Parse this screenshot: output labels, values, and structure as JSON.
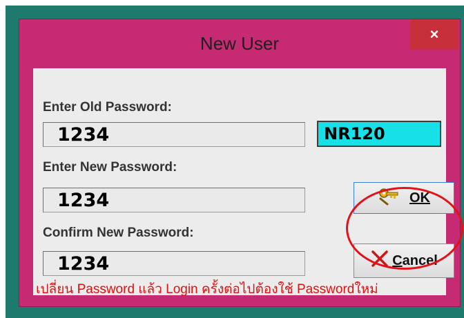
{
  "window": {
    "title": "New User",
    "close_glyph": "×"
  },
  "form": {
    "old_password_label": "Enter Old Password:",
    "old_password_value": "1234",
    "new_password_label": "Enter New Password:",
    "new_password_value": "1234",
    "confirm_password_label": "Confirm New Password:",
    "confirm_password_value": "1234",
    "user_code": "NR120"
  },
  "buttons": {
    "ok_label": "OK",
    "cancel_label": "Cancel"
  },
  "hint": "เปลี่ยน Password แล้ว Login ครั้งต่อไปต้องใช้ Passwordใหม่",
  "colors": {
    "window": "#c62a72",
    "code_box": "#17e0e6",
    "highlight": "#e0121a",
    "hint_text": "#e01010"
  }
}
